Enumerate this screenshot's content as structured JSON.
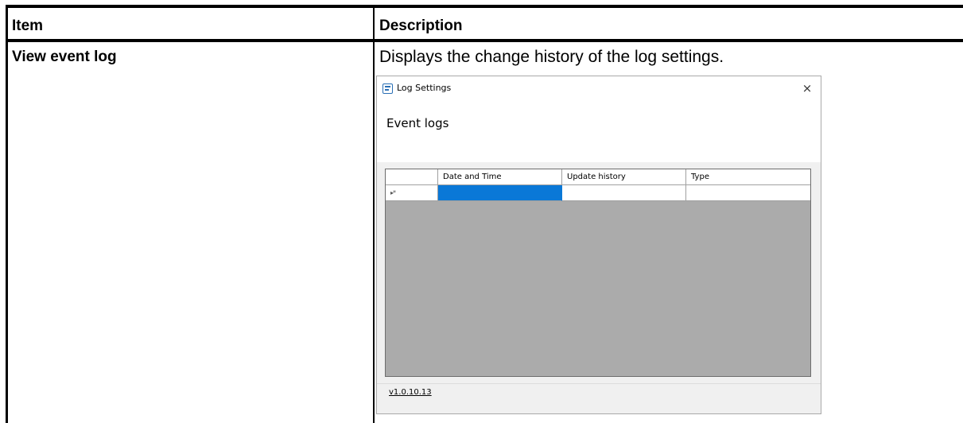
{
  "table": {
    "header_item": "Item",
    "header_description": "Description",
    "row_item": "View event log",
    "row_description": "Displays the change history of the log settings."
  },
  "dialog": {
    "title": "Log Settings",
    "close_symbol": "×",
    "heading": "Event logs",
    "grid": {
      "columns": [
        "Date and Time",
        "Update history",
        "Type"
      ],
      "new_row_marker": "▸*",
      "selection_color": "#0a78d7"
    },
    "version_link": "v1.0.10.13"
  },
  "icons": {
    "app": "log-settings-app-icon",
    "close": "close-icon"
  }
}
